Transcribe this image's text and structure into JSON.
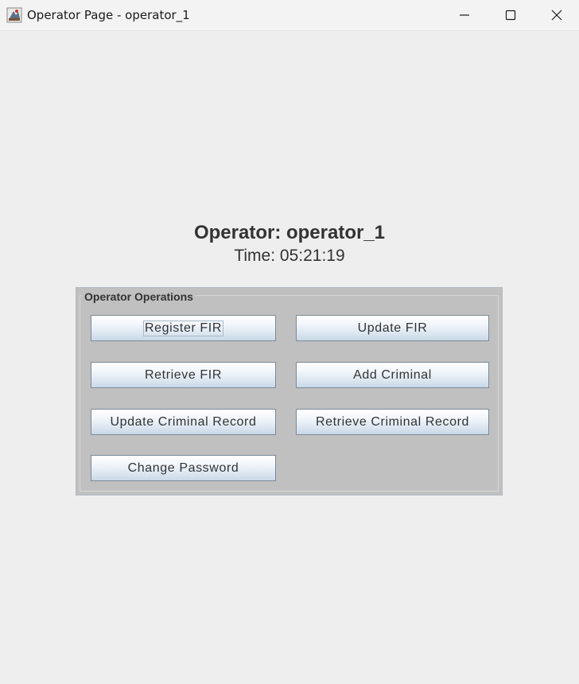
{
  "window": {
    "title": "Operator Page - operator_1",
    "icon": "java-app-icon",
    "controls": [
      "minimize-icon",
      "maximize-icon",
      "close-icon"
    ]
  },
  "header": {
    "operator": "Operator: operator_1",
    "time": "Time: 05:21:19"
  },
  "operations_panel": {
    "title": "Operator Operations",
    "buttons": {
      "register_fir": "Register FIR",
      "update_fir": "Update FIR",
      "retrieve_fir": "Retrieve FIR",
      "add_criminal": "Add Criminal",
      "update_criminal_record": "Update Criminal Record",
      "retrieve_criminal_record": "Retrieve Criminal Record",
      "change_password": "Change Password"
    },
    "focused_button": "Register FIR"
  },
  "colors": {
    "background": "#eeeeee",
    "panel": "#c0c0c0",
    "button_border": "#7a8a99",
    "text": "#333333"
  }
}
